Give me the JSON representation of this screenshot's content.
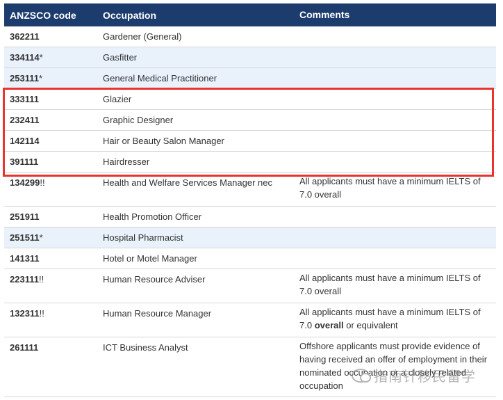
{
  "header": {
    "code": "ANZSCO code",
    "occupation": "Occupation",
    "comments": "Comments"
  },
  "rows": [
    {
      "code": "362211",
      "mark": "",
      "occupation": "Gardener (General)",
      "comment": ""
    },
    {
      "code": "334114",
      "mark": "*",
      "occupation": "Gasfitter",
      "comment": ""
    },
    {
      "code": "253111",
      "mark": "*",
      "occupation": "General Medical Practitioner",
      "comment": ""
    },
    {
      "code": "333111",
      "mark": "",
      "occupation": "Glazier",
      "comment": ""
    },
    {
      "code": "232411",
      "mark": "",
      "occupation": "Graphic Designer",
      "comment": ""
    },
    {
      "code": "142114",
      "mark": "",
      "occupation": "Hair or Beauty Salon Manager",
      "comment": ""
    },
    {
      "code": "391111",
      "mark": "",
      "occupation": "Hairdresser",
      "comment": ""
    },
    {
      "code": "134299",
      "mark": "!!",
      "occupation": "Health and Welfare Services Manager nec",
      "comment": "All applicants must have a minimum IELTS of 7.0 overall"
    },
    {
      "code": "251911",
      "mark": "",
      "occupation": "Health Promotion Officer",
      "comment": ""
    },
    {
      "code": "251511",
      "mark": "*",
      "occupation": "Hospital Pharmacist",
      "comment": ""
    },
    {
      "code": "141311",
      "mark": "",
      "occupation": "Hotel or Motel Manager",
      "comment": ""
    },
    {
      "code": "223111",
      "mark": "!!",
      "occupation": "Human Resource Adviser",
      "comment": "All applicants must have a minimum IELTS of 7.0 overall"
    },
    {
      "code": "132311",
      "mark": "!!",
      "occupation": "Human Resource Manager",
      "comment_pre": "All applicants must have a minimum IELTS of 7.0 ",
      "comment_bold": "overall",
      "comment_post": " or equivalent"
    },
    {
      "code": "261111",
      "mark": "",
      "occupation": "ICT Business Analyst",
      "comment": "Offshore applicants must provide evidence of having received an offer of employment in their nominated occupation or a closely related occupation"
    }
  ],
  "watermark": "指南针移民留学"
}
